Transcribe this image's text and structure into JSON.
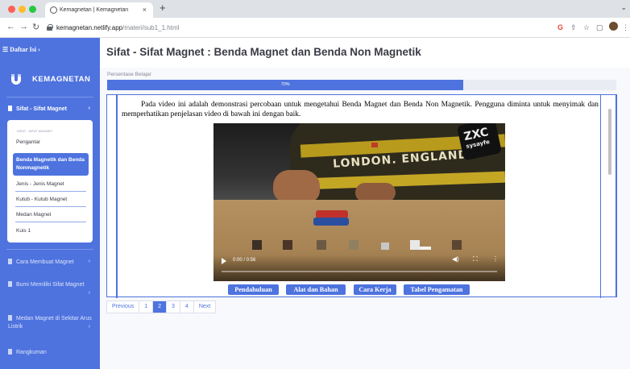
{
  "browser": {
    "tab_title": "Kemagnetan | Kemagnetan",
    "tab_close": "×",
    "new_tab": "+",
    "url_host": "kemagnetan.netlify.app",
    "url_path": "/materi/sub1_1.html"
  },
  "sidebar": {
    "toggle_label": "☰ Daftar Isi ‹",
    "brand": "KEMAGNETAN",
    "active_section": "Sifat - Sifat Magnet",
    "sub_header": "SIFAT - SIFAT MAGNET",
    "sub_items": [
      "Pengantar",
      "Benda Magnetik dan Benda Nonmagnetik",
      "Jenis - Jenis Magnet",
      "Kutub - Kutub Magnet",
      "Medan Magnet",
      "Kuis 1"
    ],
    "sections": [
      "Cara Membuat Magnet",
      "Bumi Memiliki Sifat Magnet",
      "Medan Magnet di Sekitar Arus Listrik",
      "Rangkuman"
    ]
  },
  "page": {
    "title": "Sifat - Sifat Magnet : Benda Magnet dan Benda Non Magnetik",
    "progress_label": "Persentase Belajar",
    "progress_text": "70%",
    "progress_value": 0.7,
    "description": "Pada video ini adalah demonstrasi percobaan untuk mengetahui Benda Magnet dan Benda Non Magnetik. Pengguna diminta untuk menyimak dan memperhatikan penjelasan video di bawah ini dengan baik."
  },
  "video": {
    "time": "0:00 / 0:56",
    "shirt_text": "LONDON. ENGLAND",
    "badge_text": "ZXC",
    "badge_sub": "sysayfe"
  },
  "tabs": [
    "Pendahuluan",
    "Alat dan Bahan",
    "Cara Kerja",
    "Tabel Pengamatan"
  ],
  "pagination": {
    "previous": "Previous",
    "pages": [
      "1",
      "2",
      "3",
      "4"
    ],
    "active_page": "2",
    "next": "Next"
  },
  "colors": {
    "primary": "#4e73df",
    "background": "#f8f9fc"
  }
}
